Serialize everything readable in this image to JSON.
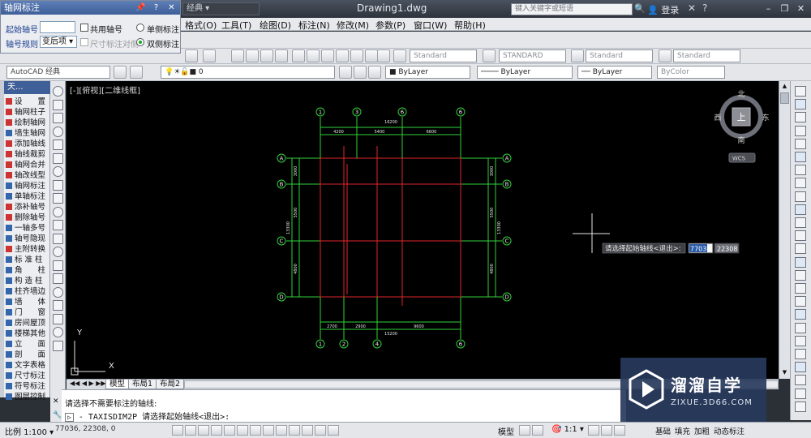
{
  "titlebar": {
    "workspace": "经典",
    "document": "Drawing1.dwg",
    "search_placeholder": "键入关键字或短语",
    "login": "登录",
    "min": "–",
    "restore": "❐",
    "close": "✕"
  },
  "menu": [
    "格式(O)",
    "工具(T)",
    "绘图(D)",
    "标注(N)",
    "修改(M)",
    "参数(P)",
    "窗口(W)",
    "帮助(H)"
  ],
  "toolbar": {
    "text_style": "Standard",
    "dim_style": "STANDARD",
    "table_style": "Standard",
    "mleader_style": "Standard",
    "workspace": "AutoCAD 经典",
    "layer": "0",
    "color": "ByLayer",
    "linetype": "ByLayer",
    "lineweight": "ByLayer",
    "plotstyle": "ByColor"
  },
  "dialog": {
    "title": "轴网标注",
    "start_label": "起始轴号",
    "start_value": "",
    "shared_label": "共用轴号",
    "single_label": "单侧标注",
    "rule_label": "轴号规则",
    "rule_value": "变后项",
    "dim_align_label": "尺寸标注对侧",
    "double_label": "双侧标注"
  },
  "palette": {
    "header": "天...",
    "items": [
      {
        "label": "设　　置",
        "color": "#c33"
      },
      {
        "label": "轴网柱子",
        "color": "#c33"
      },
      {
        "label": "绘制轴网",
        "color": "#c33"
      },
      {
        "label": "墙生轴网",
        "color": "#36a"
      },
      {
        "label": "添加轴线",
        "color": "#c33"
      },
      {
        "label": "轴线裁剪",
        "color": "#c33"
      },
      {
        "label": "轴网合并",
        "color": "#c33"
      },
      {
        "label": "轴改线型",
        "color": "#c33"
      },
      {
        "label": "轴网标注",
        "color": "#36a"
      },
      {
        "label": "单轴标注",
        "color": "#36a"
      },
      {
        "label": "添补轴号",
        "color": "#c33"
      },
      {
        "label": "删除轴号",
        "color": "#c33"
      },
      {
        "label": "一轴多号",
        "color": "#36a"
      },
      {
        "label": "轴号隐现",
        "color": "#36a"
      },
      {
        "label": "主附转换",
        "color": "#c33"
      },
      {
        "label": "标 准 柱",
        "color": "#36a"
      },
      {
        "label": "角　　柱",
        "color": "#36a"
      },
      {
        "label": "构 造 柱",
        "color": "#36a"
      },
      {
        "label": "柱齐墙边",
        "color": "#36a"
      },
      {
        "label": "墙　　体",
        "color": "#36a"
      },
      {
        "label": "门　　窗",
        "color": "#36a"
      },
      {
        "label": "房间屋顶",
        "color": "#36a"
      },
      {
        "label": "楼梯其他",
        "color": "#36a"
      },
      {
        "label": "立　　面",
        "color": "#36a"
      },
      {
        "label": "剖　　面",
        "color": "#36a"
      },
      {
        "label": "文字表格",
        "color": "#36a"
      },
      {
        "label": "尺寸标注",
        "color": "#36a"
      },
      {
        "label": "符号标注",
        "color": "#36a"
      },
      {
        "label": "图层控制",
        "color": "#36a"
      }
    ]
  },
  "canvas": {
    "view_label": "[-][俯视][二维线框]",
    "top_axis_labels": [
      "1",
      "3",
      "6",
      "6"
    ],
    "bottom_axis_labels": [
      "1",
      "2",
      "4",
      "6"
    ],
    "left_axis_labels": [
      "A",
      "B",
      "C",
      "D"
    ],
    "right_axis_labels": [
      "A",
      "B",
      "C",
      "D"
    ],
    "top_dims": [
      "4200",
      "5400",
      "6600"
    ],
    "top_total": "16200",
    "bottom_dims": [
      "2700",
      "2900",
      "9600"
    ],
    "bottom_total": "15200",
    "left_dims": [
      "3000",
      "5500",
      "4800"
    ],
    "left_total": "13300",
    "right_dims": [
      "3000",
      "5500",
      "4800"
    ],
    "right_total": "13300",
    "viewcube": {
      "n": "北",
      "s": "南",
      "e": "东",
      "w": "西",
      "top": "上",
      "wcs": "WCS"
    },
    "prompt": "请选择起始轴线<退出>:",
    "coord_x": "77036",
    "coord_y": "22308",
    "ucs_y": "Y",
    "ucs_x": "X"
  },
  "tabs": [
    "模型",
    "布局1",
    "布局2"
  ],
  "command": {
    "history": "请选择不需要标注的轴线:",
    "line": "- TAXISDIM2P 请选择起始轴线<退出>:"
  },
  "status": {
    "scale": "比例 1:100",
    "coords": "77036, 22308, 0",
    "model": "模型",
    "anno_scale": "1:1",
    "right_labels": [
      "基础",
      "填充",
      "加粗",
      "动态标注"
    ]
  },
  "watermark": {
    "name": "溜溜自学",
    "url": "ZIXUE.3D66.COM"
  }
}
